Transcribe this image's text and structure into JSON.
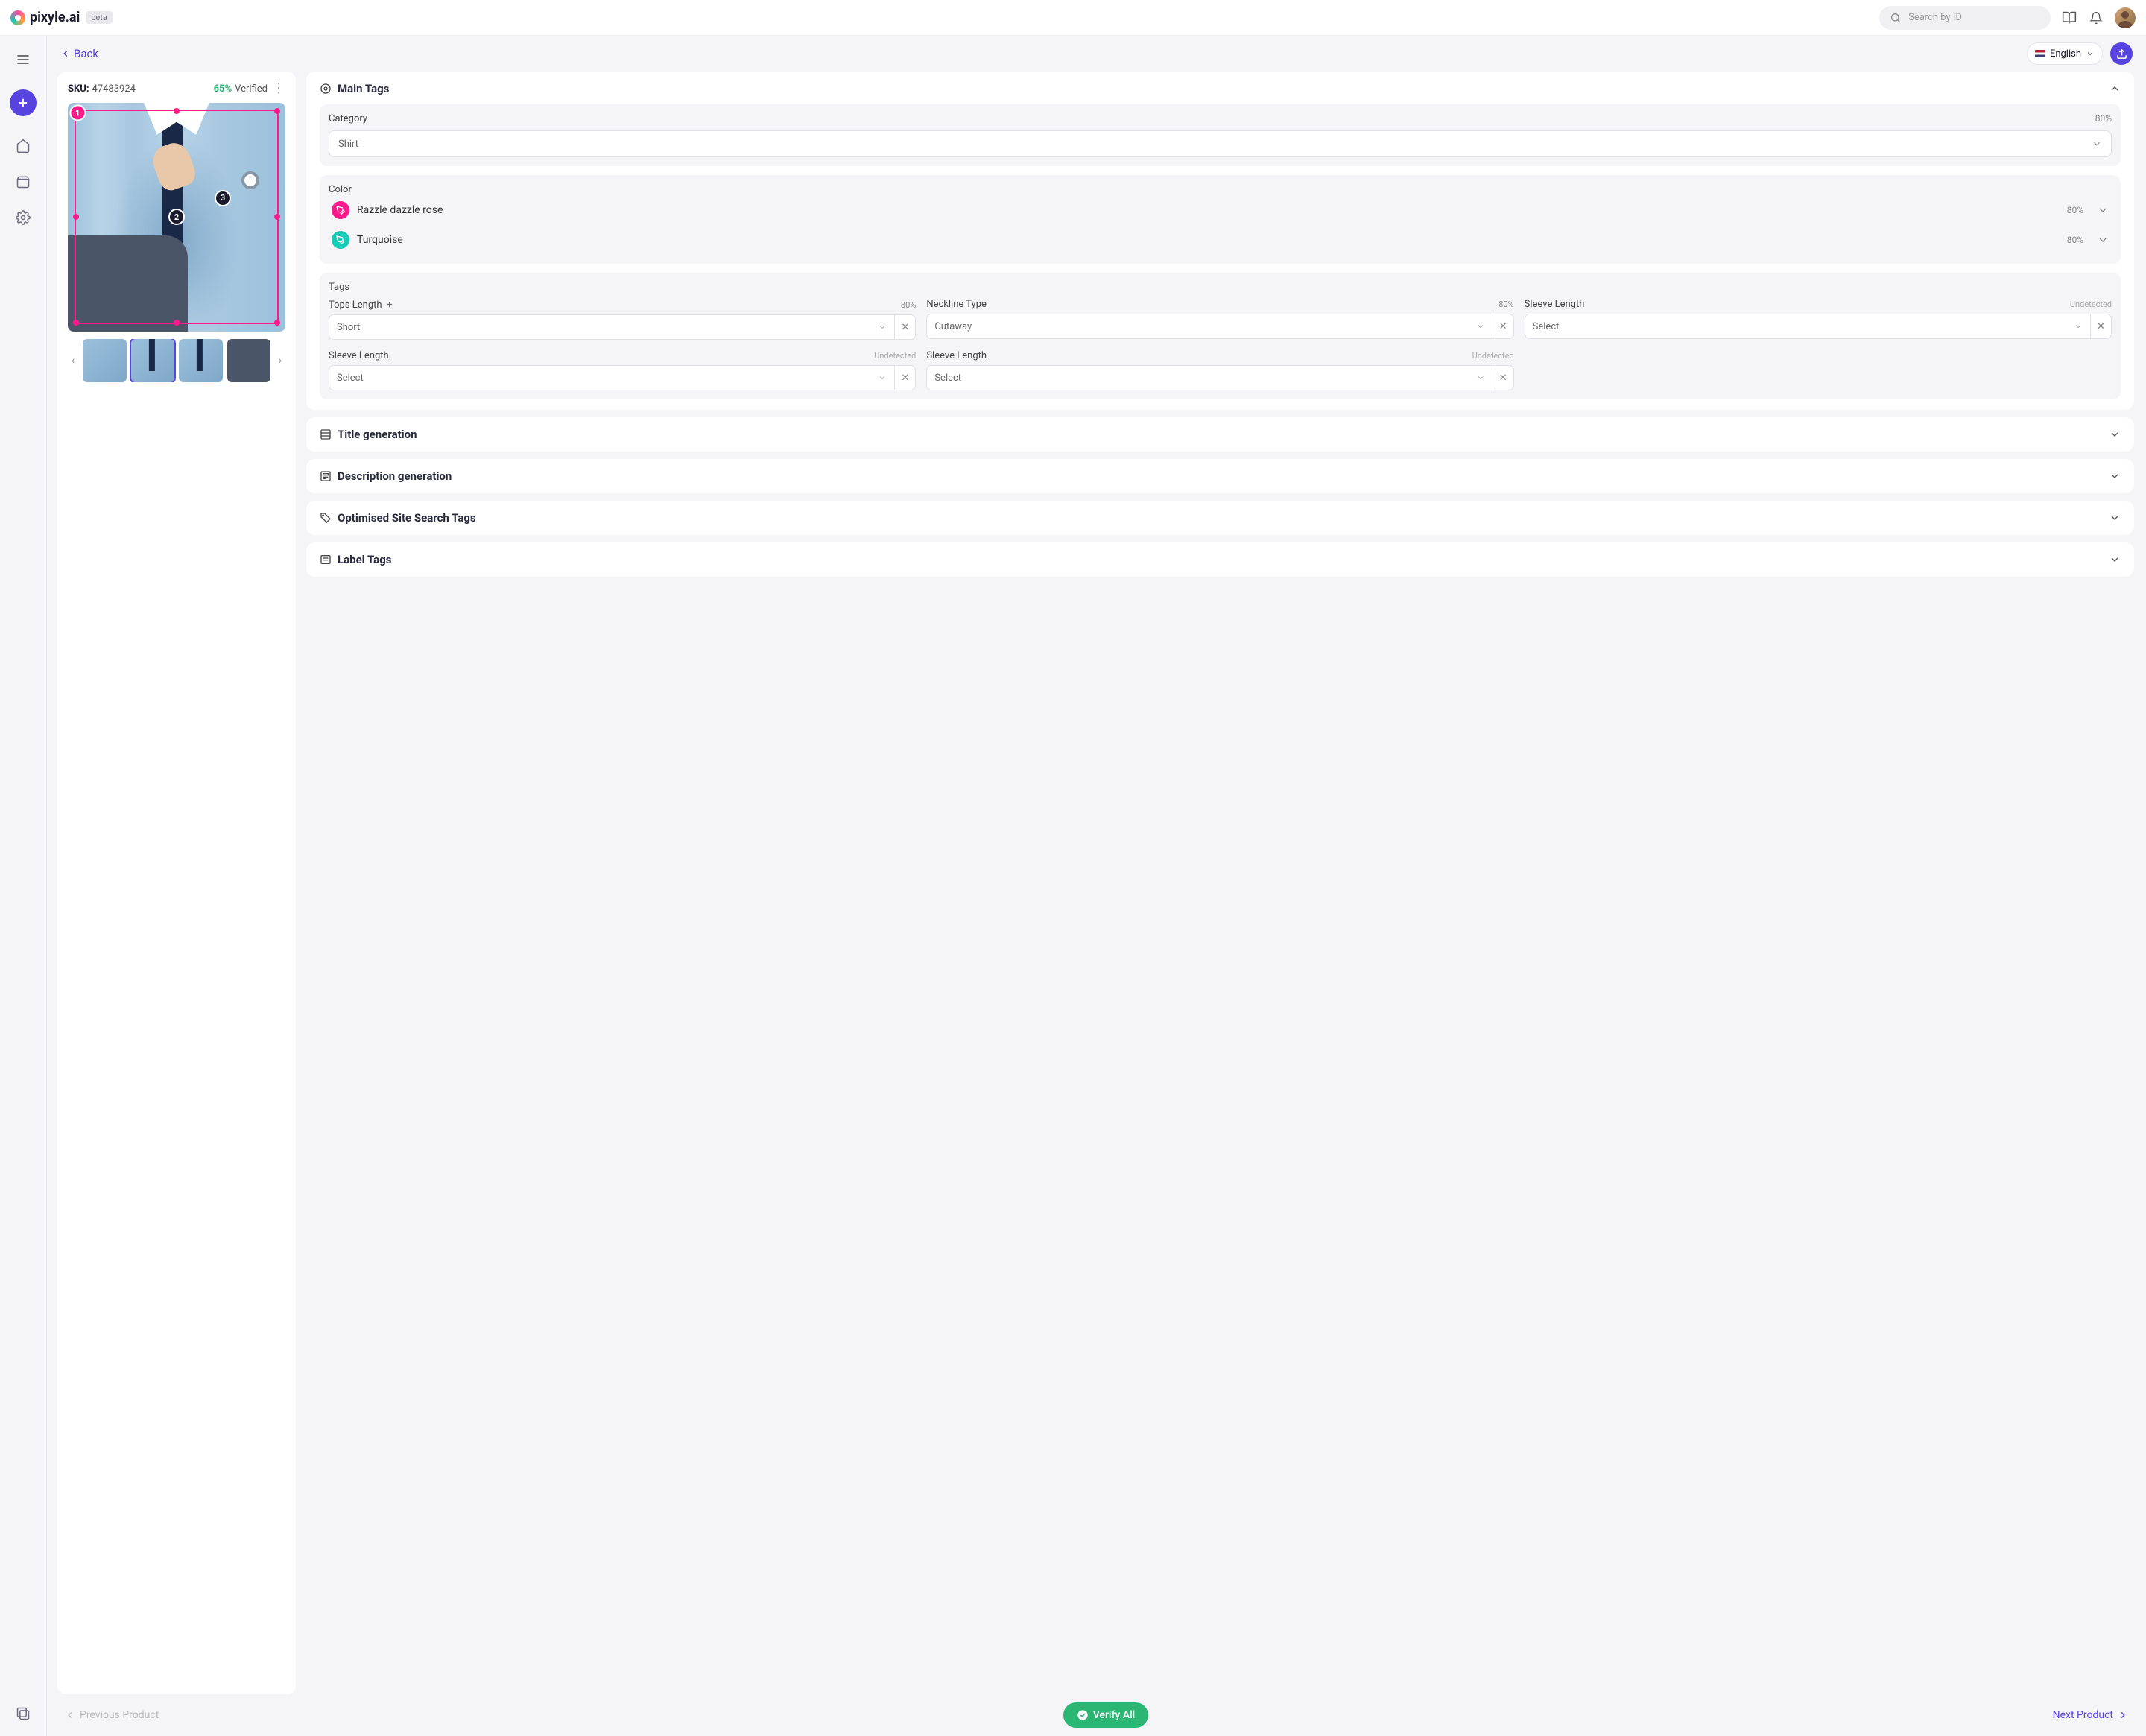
{
  "brand": {
    "name": "pixyle.ai",
    "badge": "beta"
  },
  "header": {
    "search_placeholder": "Search by ID"
  },
  "toolbar": {
    "back": "Back",
    "language": "English"
  },
  "product": {
    "sku_label": "SKU:",
    "sku_value": "47483924",
    "verified_pct": "65%",
    "verified_label": "Verified",
    "markers": {
      "m1": "1",
      "m2": "2",
      "m3": "3"
    }
  },
  "sections": {
    "main_tags": {
      "title": "Main Tags",
      "category": {
        "label": "Category",
        "value": "Shirt",
        "pct": "80%"
      },
      "color": {
        "label": "Color",
        "items": [
          {
            "name": "Razzle dazzle rose",
            "hex": "#ff1a8c",
            "pct": "80%"
          },
          {
            "name": "Turquoise",
            "hex": "#17c9b7",
            "pct": "80%"
          }
        ]
      },
      "tags": {
        "label": "Tags",
        "items": [
          {
            "label": "Tops Length",
            "value": "Short",
            "pct": "80%",
            "add": true
          },
          {
            "label": "Neckline Type",
            "value": "Cutaway",
            "pct": "80%"
          },
          {
            "label": "Sleeve Length",
            "value": "Select",
            "undetected": "Undetected"
          },
          {
            "label": "Sleeve Length",
            "value": "Select",
            "undetected": "Undetected"
          },
          {
            "label": "Sleeve Length",
            "value": "Select",
            "undetected": "Undetected"
          }
        ]
      }
    },
    "title_gen": "Title generation",
    "desc_gen": "Description generation",
    "search_tags": "Optimised Site Search Tags",
    "label_tags": "Label Tags"
  },
  "footer": {
    "prev": "Previous Product",
    "verify": "Verify All",
    "next": "Next Product"
  }
}
